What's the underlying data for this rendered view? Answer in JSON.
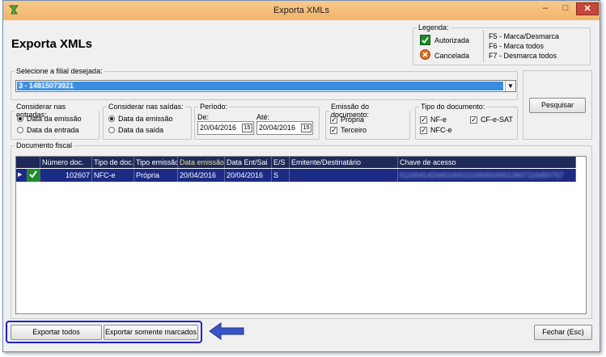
{
  "window": {
    "title": "Exporta XMLs"
  },
  "heading": "Exporta XMLs",
  "legend": {
    "title": "Legenda:",
    "autorizada": "Autorizada",
    "cancelada": "Cancelada",
    "keys": [
      "F5 - Marca/Desmarca",
      "F6 - Marca todos",
      "F7 - Desmarca todos"
    ]
  },
  "filial": {
    "legend": "Selecione a filial desejada:",
    "value": "3 - 14815073921"
  },
  "pesquisar": "Pesquisar",
  "entradas": {
    "legend": "Considerar nas entradas:",
    "opt1": "Data da emissão",
    "opt2": "Data da entrada"
  },
  "saidas": {
    "legend": "Considerar nas saídas:",
    "opt1": "Data da emissão",
    "opt2": "Data da saída"
  },
  "periodo": {
    "legend": "Período:",
    "de_label": "De:",
    "ate_label": "Até:",
    "de": "20/04/2016",
    "ate": "20/04/2016"
  },
  "emissao": {
    "legend": "Emissão do documento:",
    "propria": "Própria",
    "terceiro": "Terceiro"
  },
  "tipo": {
    "legend": "Tipo do documento:",
    "nfe": "NF-e",
    "nfce": "NFC-e",
    "cfe": "CF-e-SAT"
  },
  "documento": {
    "legend": "Documento fiscal",
    "columns": [
      "Número doc.",
      "Tipo de doc.",
      "Tipo emissão",
      "Data emissão",
      "Data Ent/Sai",
      "E/S",
      "Emitente/Destinatário",
      "Chave de acesso"
    ],
    "rows": [
      {
        "numero": "102607",
        "tipo": "NFC-e",
        "emissao": "Própria",
        "data_emissao": "20/04/2016",
        "data_ent": "20/04/2016",
        "es": "S",
        "emitente": "",
        "chave": "51160414244010001116500100012607116450757"
      }
    ]
  },
  "buttons": {
    "exportar_todos": "Exportar todos",
    "exportar_marcados": "Exportar somente marcados",
    "fechar": "Fechar (Esc)"
  },
  "colors": {
    "highlight_border": "#2222cc",
    "arrow": "#3a55c8",
    "grid_header": "#1f2a5a",
    "grid_row": "#1c2b84"
  }
}
